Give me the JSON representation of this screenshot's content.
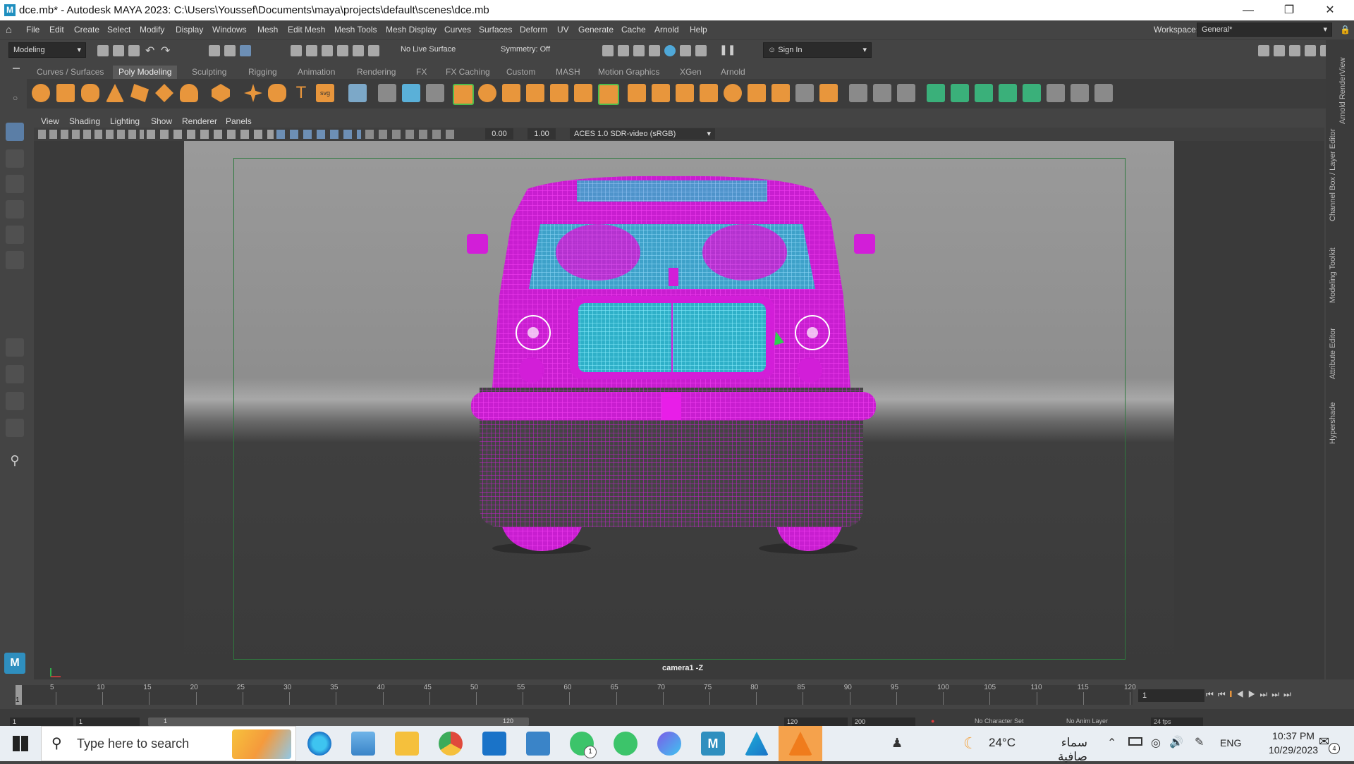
{
  "window": {
    "title": "dce.mb* - Autodesk MAYA 2023: C:\\Users\\Youssef\\Documents\\maya\\projects\\default\\scenes\\dce.mb",
    "logo_letter": "M"
  },
  "menubar": {
    "items": [
      "File",
      "Edit",
      "Create",
      "Select",
      "Modify",
      "Display",
      "Windows",
      "Mesh",
      "Edit Mesh",
      "Mesh Tools",
      "Mesh Display",
      "Curves",
      "Surfaces",
      "Deform",
      "UV",
      "Generate",
      "Cache",
      "Arnold",
      "Help"
    ],
    "workspace_label": "Workspace:",
    "workspace_value": "General*"
  },
  "statusline": {
    "mode": "Modeling",
    "live_surface": "No Live Surface",
    "symmetry": "Symmetry: Off",
    "sign_in": "Sign In"
  },
  "shelf": {
    "tabs": [
      "Curves / Surfaces",
      "Poly Modeling",
      "Sculpting",
      "Rigging",
      "Animation",
      "Rendering",
      "FX",
      "FX Caching",
      "Custom",
      "MASH",
      "Motion Graphics",
      "XGen",
      "Arnold"
    ],
    "active_tab": 1
  },
  "viewport": {
    "menus": [
      "View",
      "Shading",
      "Lighting",
      "Show",
      "Renderer",
      "Panels"
    ],
    "exposure": "0.00",
    "gamma": "1.00",
    "color_space": "ACES 1.0 SDR-video (sRGB)",
    "camera_label": "camera1 -Z"
  },
  "side_tabs": [
    "Arnold RenderView",
    "Channel Box / Layer Editor",
    "Modeling Toolkit",
    "Attribute Editor",
    "Hypershade"
  ],
  "timeline": {
    "ticks": [
      "5",
      "10",
      "15",
      "20",
      "25",
      "30",
      "35",
      "40",
      "45",
      "50",
      "55",
      "60",
      "65",
      "70",
      "75",
      "80",
      "85",
      "90",
      "95",
      "100",
      "105",
      "110",
      "115",
      "120"
    ],
    "start_marker": "1",
    "current_frame": "1",
    "range_start": "1",
    "range_inner_start": "1",
    "range_inner_end": "120",
    "range_end_a": "120",
    "range_end_b": "200",
    "character_set": "No Character Set",
    "anim_layer": "No Anim Layer",
    "fps": "24 fps"
  },
  "taskbar": {
    "search_placeholder": "Type here to search",
    "whatsapp_badge": "1",
    "weather_temp": "24°C",
    "weather_desc": "سماء صافية",
    "language": "ENG",
    "time": "10:37 PM",
    "date": "10/29/2023",
    "notification_count": "4"
  },
  "colors": {
    "wire_magenta": "#e81ee8",
    "wire_cyan": "#3fd6f0",
    "maya_bg": "#444444",
    "shelf_orange": "#e8963c"
  }
}
